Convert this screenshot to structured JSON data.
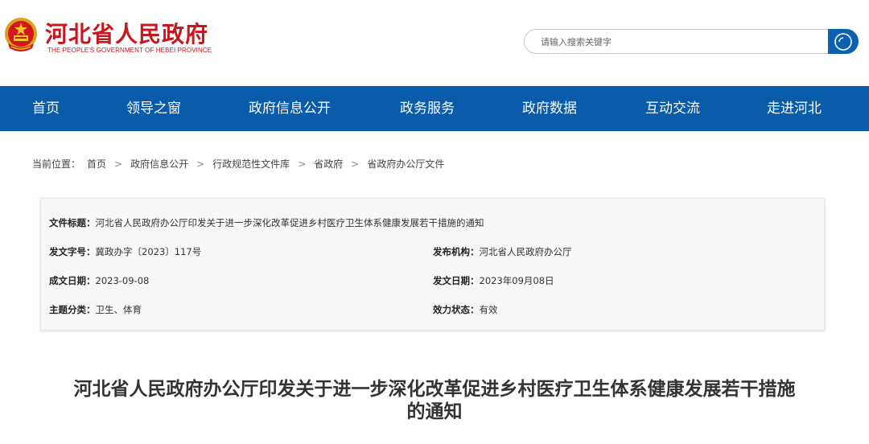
{
  "header": {
    "logo_cn": "河北省人民政府",
    "logo_en": "THE PEOPLE'S GOVERNMENT OF HEBEI PROVINCE",
    "emblem_icon": "national-emblem-icon",
    "search": {
      "placeholder": "请输入搜索关键字",
      "button_icon": "search-icon"
    }
  },
  "nav": {
    "items": [
      {
        "label": "首页"
      },
      {
        "label": "领导之窗"
      },
      {
        "label": "政府信息公开"
      },
      {
        "label": "政务服务"
      },
      {
        "label": "政府数据"
      },
      {
        "label": "互动交流"
      },
      {
        "label": "走进河北"
      }
    ]
  },
  "breadcrumb": {
    "label": "当前位置：",
    "separator": ">",
    "items": [
      {
        "label": "首页"
      },
      {
        "label": "政府信息公开"
      },
      {
        "label": "行政规范性文件库"
      },
      {
        "label": "省政府"
      },
      {
        "label": "省政府办公厅文件"
      }
    ]
  },
  "meta": {
    "title": {
      "key": "文件标题：",
      "value": "河北省人民政府办公厅印发关于进一步深化改革促进乡村医疗卫生体系健康发展若干措施的通知"
    },
    "doc_no": {
      "key": "发文字号：",
      "value": "冀政办字〔2023〕117号"
    },
    "issuer": {
      "key": "发布机构：",
      "value": "河北省人民政府办公厅"
    },
    "written_date": {
      "key": "成文日期：",
      "value": "2023-09-08"
    },
    "issue_date": {
      "key": "发文日期：",
      "value": "2023年09月08日"
    },
    "category": {
      "key": "主题分类：",
      "value": "卫生、体育"
    },
    "status": {
      "key": "效力状态：",
      "value": "有效"
    }
  },
  "document": {
    "title_line1": "河北省人民政府办公厅印发关于进一步深化改革促进乡村医疗卫生体系健康发展若干措施",
    "title_line2": "的通知"
  },
  "colors": {
    "brand_red": "#c8161d",
    "nav_blue": "#0a5cab",
    "search_button_blue": "#0d62b0"
  }
}
